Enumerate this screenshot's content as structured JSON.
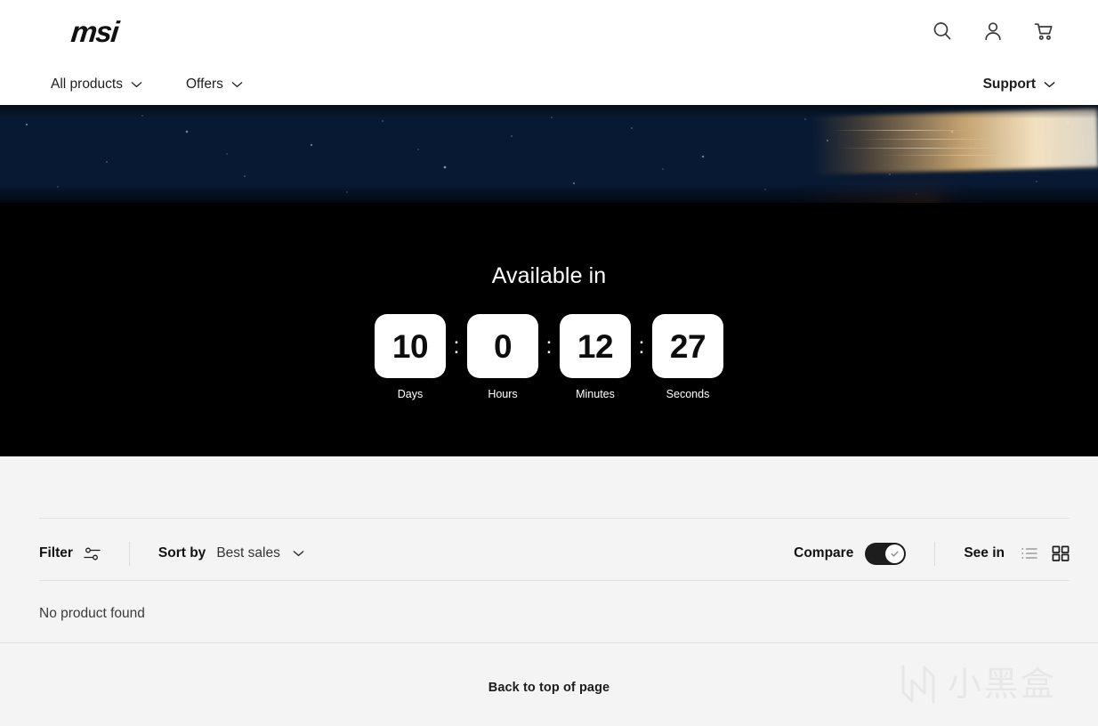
{
  "header": {
    "logo_text": "msi",
    "icons": [
      {
        "name": "search-icon",
        "label": "Search"
      },
      {
        "name": "account-icon",
        "label": "Account"
      },
      {
        "name": "cart-icon",
        "label": "Cart"
      }
    ]
  },
  "nav": {
    "left_items": [
      {
        "label": "All products",
        "has_chevron": true
      },
      {
        "label": "Offers",
        "has_chevron": true
      }
    ],
    "right_items": [
      {
        "label": "Support",
        "has_chevron": true
      }
    ]
  },
  "banner": {
    "alt": "Graphics card flying through space with fiery trail"
  },
  "countdown": {
    "title": "Available in",
    "separator": ":",
    "units": [
      {
        "value": "10",
        "label": "Days"
      },
      {
        "value": "0",
        "label": "Hours"
      },
      {
        "value": "12",
        "label": "Minutes"
      },
      {
        "value": "27",
        "label": "Seconds"
      }
    ]
  },
  "toolbar": {
    "filter_label": "Filter",
    "sort_label": "Sort by",
    "sort_value": "Best sales",
    "compare_label": "Compare",
    "compare_enabled": "on",
    "see_in_label": "See in",
    "view_list_active": "false",
    "view_grid_active": "true"
  },
  "results": {
    "empty_message": "No product found"
  },
  "footer": {
    "back_to_top": "Back to top of page"
  },
  "watermark": {
    "text": "小黑盒"
  },
  "colors": {
    "page_bg": "#ffffff",
    "content_bg": "#f4f4f4",
    "countdown_bg": "#000000",
    "text_primary": "#111111",
    "divider": "#e2e2e2",
    "toggle_on": "#1d1d1d",
    "watermark": "#e7e7e7"
  }
}
